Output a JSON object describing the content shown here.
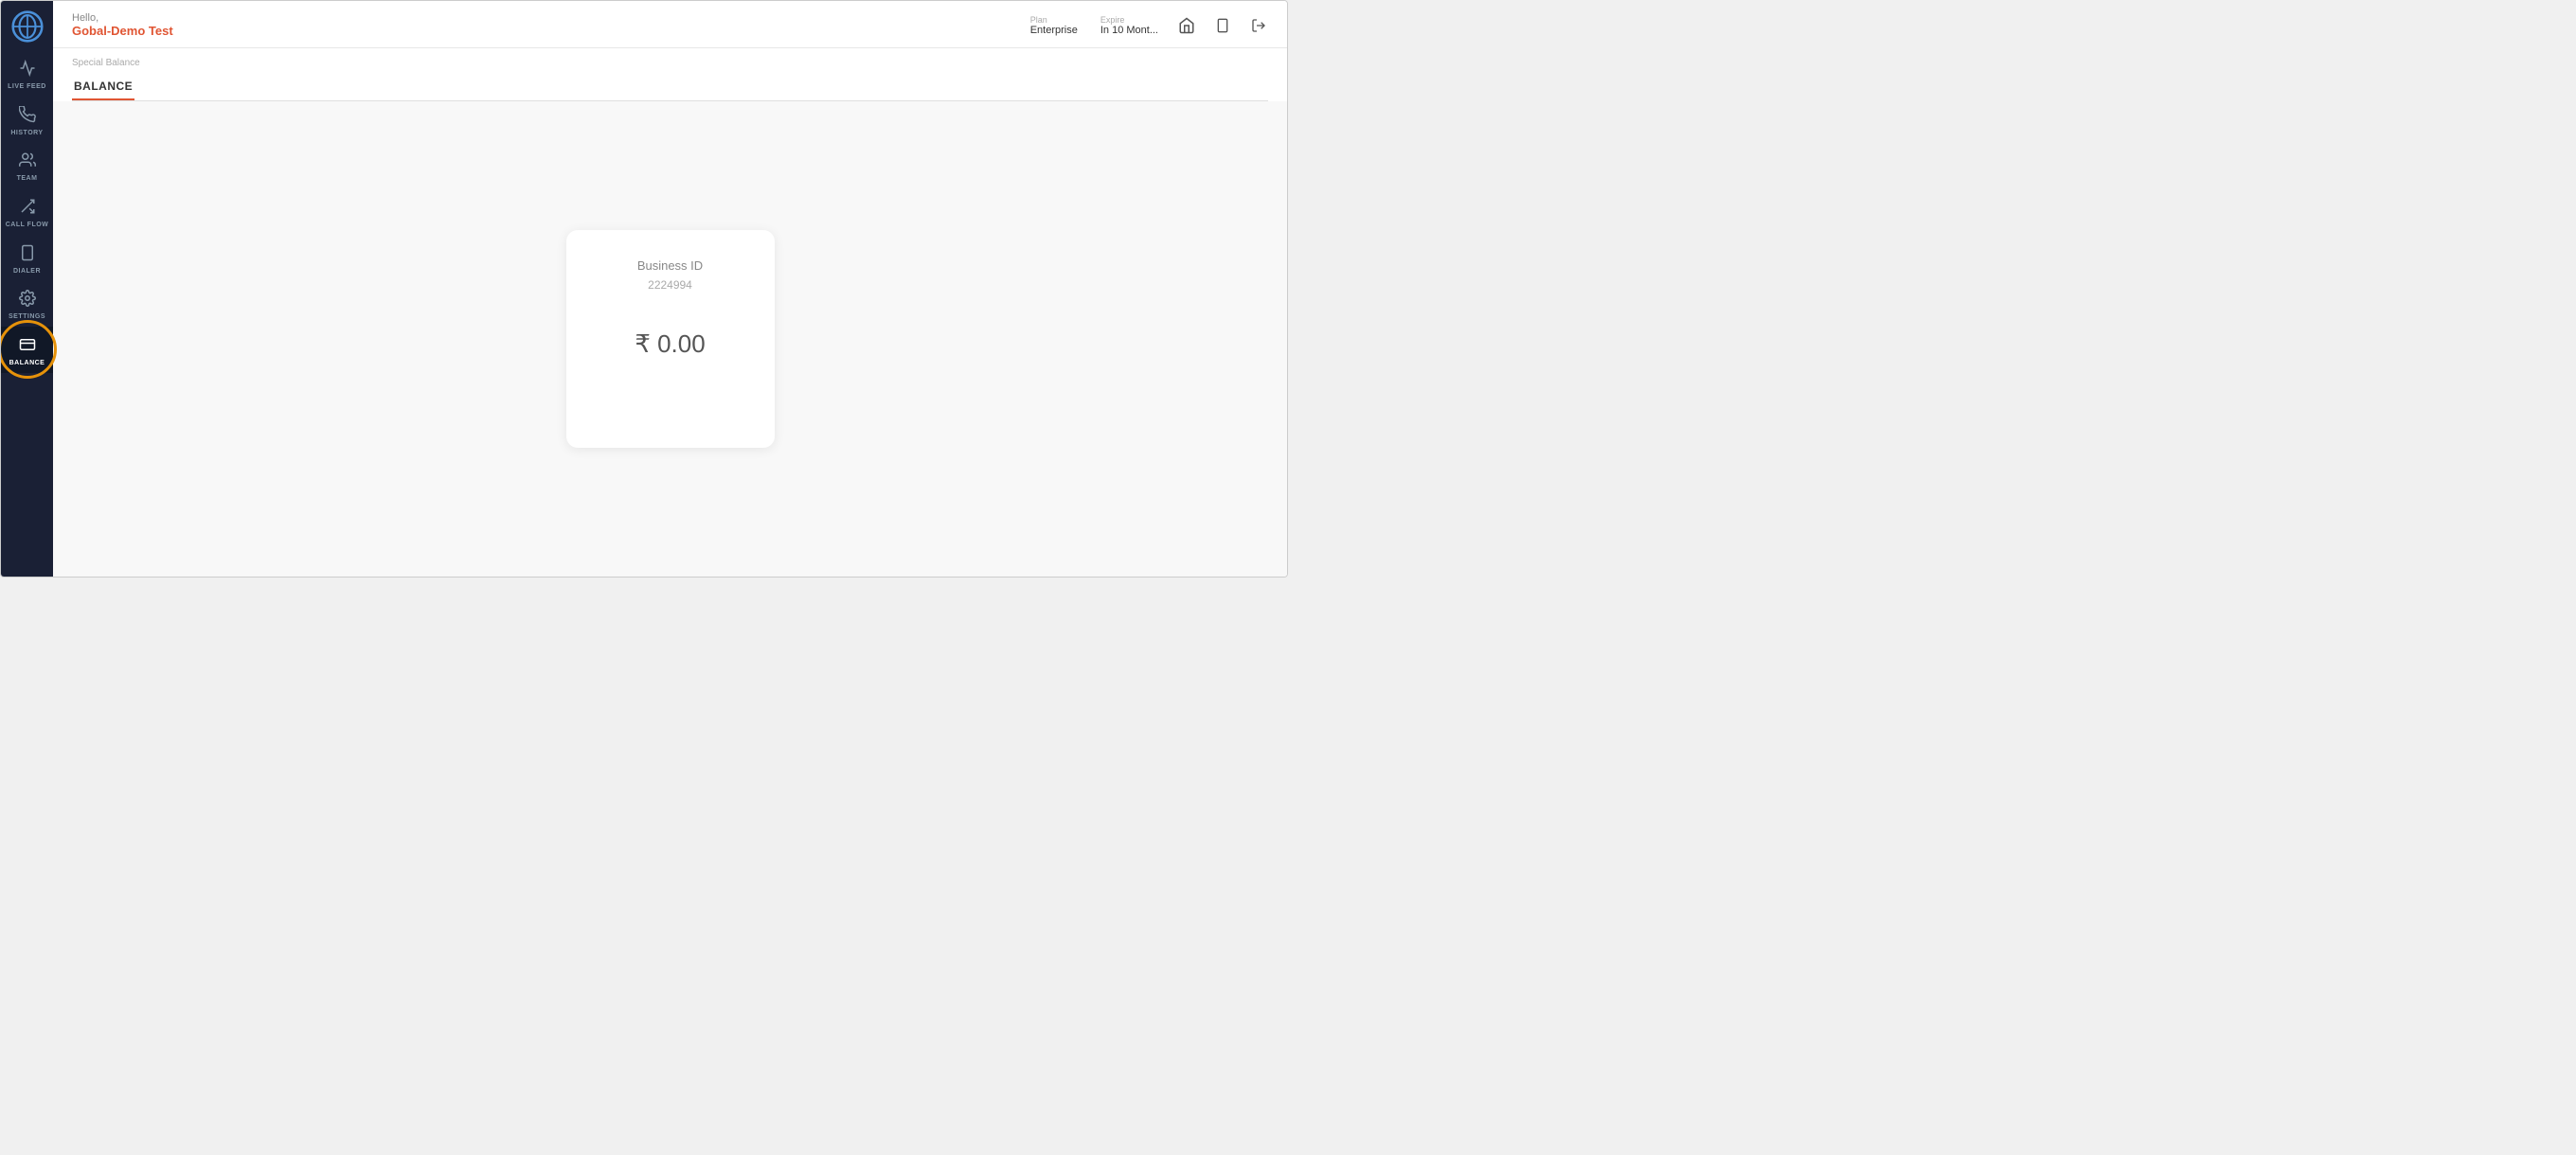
{
  "sidebar": {
    "items": [
      {
        "id": "live-feed",
        "label": "LIVE FEED",
        "icon": "📈"
      },
      {
        "id": "history",
        "label": "HISTORY",
        "icon": "📞"
      },
      {
        "id": "team",
        "label": "TEAM",
        "icon": "👥"
      },
      {
        "id": "call-flow",
        "label": "CALL FLOW",
        "icon": "⇄"
      },
      {
        "id": "dialer",
        "label": "DIALER",
        "icon": "📱"
      },
      {
        "id": "settings",
        "label": "SETTINGS",
        "icon": "⚙"
      },
      {
        "id": "balance",
        "label": "BALANCE",
        "icon": "💳",
        "active": true,
        "highlighted": true
      }
    ]
  },
  "topbar": {
    "greeting": "Hello,",
    "user_name": "Gobal-Demo Test",
    "plan_label": "Plan",
    "plan_value": "Enterprise",
    "expire_label": "Expire",
    "expire_value": "In 10 Mont..."
  },
  "content": {
    "section_label": "Special Balance",
    "tab_label": "BALANCE"
  },
  "balance_card": {
    "business_id_label": "Business ID",
    "business_id_value": "2224994",
    "balance_amount": "₹ 0.00"
  }
}
